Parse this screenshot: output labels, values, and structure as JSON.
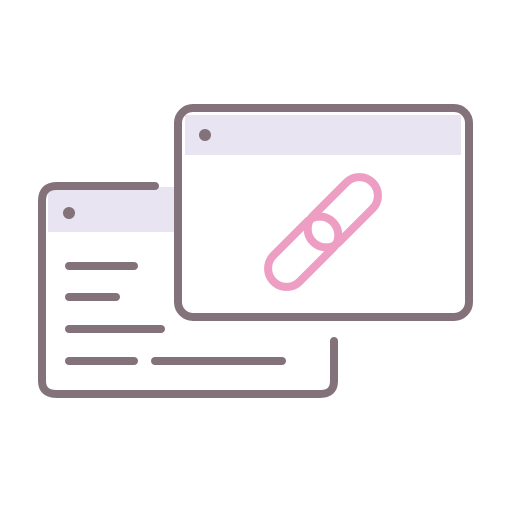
{
  "icon": {
    "name": "linked-browser-windows-icon",
    "colors": {
      "outline": "#84727A",
      "window_header_fill": "#E8E4F1",
      "link_accent": "#EE9DC3",
      "background": "#FFFFFF"
    },
    "elements": {
      "back_window": {
        "icon": "browser-window-icon",
        "text_lines": 5
      },
      "front_window": {
        "icon": "browser-window-icon"
      },
      "link": {
        "icon": "chain-link-icon"
      }
    }
  }
}
